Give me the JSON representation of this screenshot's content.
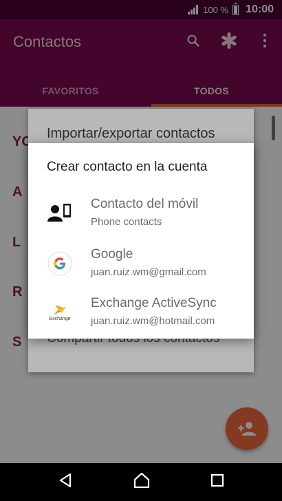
{
  "status_bar": {
    "battery_text": "100 %",
    "time": "10:00"
  },
  "app_bar": {
    "title": "Contactos",
    "actions": [
      "search-icon",
      "asterisk-icon",
      "more-vert-icon"
    ],
    "tabs": [
      {
        "label": "FAVORITOS",
        "active": false
      },
      {
        "label": "TODOS",
        "active": true
      }
    ]
  },
  "list": {
    "index_letters": [
      "YO",
      "A",
      "L",
      "R",
      "S"
    ]
  },
  "background_dialog": {
    "title": "Importar/exportar contactos",
    "item": "Compartir todos los contactos"
  },
  "dialog": {
    "title": "Crear contacto en la cuenta",
    "accounts": [
      {
        "name": "Contacto del móvil",
        "sub": "Phone contacts",
        "icon": "phone-contact-icon"
      },
      {
        "name": "Google",
        "sub": "juan.ruiz.wm@gmail.com",
        "icon": "google-icon"
      },
      {
        "name": "Exchange ActiveSync",
        "sub": "juan.ruiz.wm@hotmail.com",
        "icon": "exchange-icon",
        "logo_text": "Exchange"
      }
    ]
  },
  "colors": {
    "primary": "#7a0a4f",
    "status_bar": "#4a0131",
    "accent": "#ee6a3d",
    "letter": "#8e1b5f"
  },
  "nav_bar": {
    "buttons": [
      "back-icon",
      "home-icon",
      "recents-icon"
    ]
  }
}
